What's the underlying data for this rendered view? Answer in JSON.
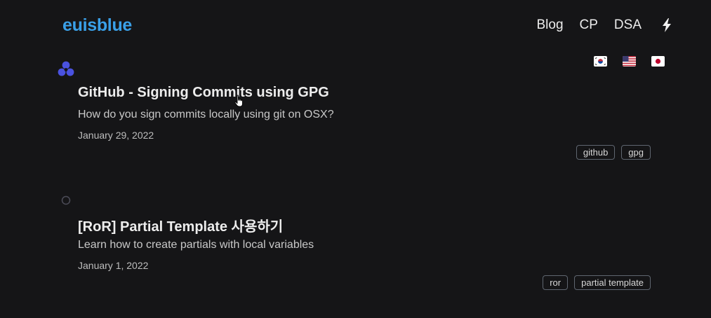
{
  "header": {
    "logo": "euisblue",
    "nav": [
      {
        "label": "Blog"
      },
      {
        "label": "CP"
      },
      {
        "label": "DSA"
      }
    ],
    "theme_toggle_icon": "lightning-bolt-icon"
  },
  "languages": [
    {
      "name": "Korean",
      "icon": "korea-flag-icon"
    },
    {
      "name": "English",
      "icon": "us-flag-icon"
    },
    {
      "name": "Japanese",
      "icon": "japan-flag-icon"
    }
  ],
  "posts": [
    {
      "title": "GitHub - Signing Commits using GPG",
      "description": "How do you sign commits locally using git on OSX?",
      "date": "January 29, 2022",
      "tags": [
        "github",
        "gpg"
      ],
      "marker_icon": "three-dot-cluster-icon"
    },
    {
      "title": "[RoR] Partial Template 사용하기",
      "description": "Learn how to create partials with local variables",
      "date": "January 1, 2022",
      "tags": [
        "ror",
        "partial template"
      ],
      "marker_icon": "circle-outline-icon"
    }
  ],
  "colors": {
    "background": "#151517",
    "logo": "#3aa0e8",
    "marker": "#4a52e0"
  }
}
